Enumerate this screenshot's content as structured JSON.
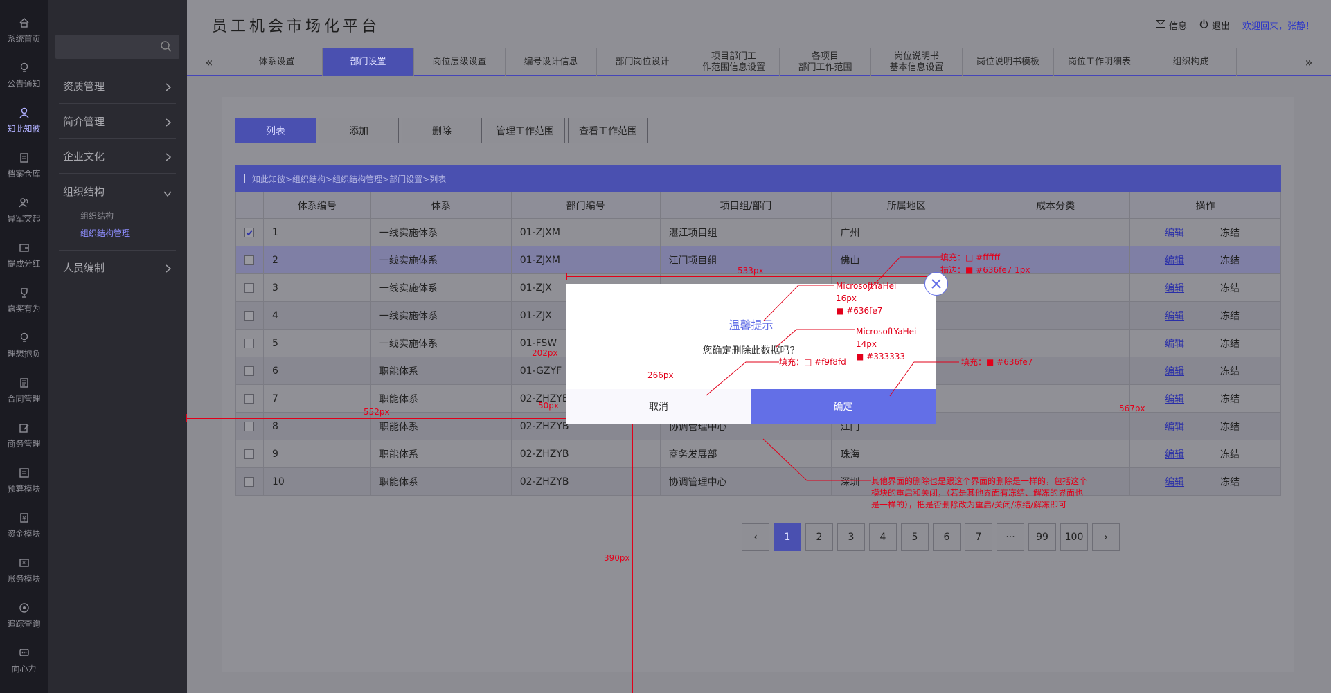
{
  "app": {
    "title": "员工机会市场化平台"
  },
  "rail": [
    {
      "label": "系统首页",
      "icon": "home-icon"
    },
    {
      "label": "公告通知",
      "icon": "bulb-icon"
    },
    {
      "label": "知此知彼",
      "icon": "user-icon",
      "active": true
    },
    {
      "label": "档案仓库",
      "icon": "file-icon"
    },
    {
      "label": "异军突起",
      "icon": "users-icon"
    },
    {
      "label": "提成分红",
      "icon": "wallet-icon"
    },
    {
      "label": "嘉奖有为",
      "icon": "trophy-icon"
    },
    {
      "label": "理想抱负",
      "icon": "bulb-icon"
    },
    {
      "label": "合同管理",
      "icon": "contract-icon"
    },
    {
      "label": "商务管理",
      "icon": "edit-icon"
    },
    {
      "label": "预算模块",
      "icon": "budget-icon"
    },
    {
      "label": "资金模块",
      "icon": "fund-icon"
    },
    {
      "label": "账务模块",
      "icon": "ledger-icon"
    },
    {
      "label": "追踪查询",
      "icon": "target-icon"
    },
    {
      "label": "向心力",
      "icon": "chat-icon"
    }
  ],
  "nav": {
    "groups": [
      "资质管理",
      "简介管理",
      "企业文化",
      "组织结构",
      "人员编制"
    ],
    "sub_items": [
      "组织结构",
      "组织结构管理"
    ]
  },
  "topbar": {
    "info": "信息",
    "logout": "退出",
    "welcome": "欢迎回来，张静！"
  },
  "tabs": [
    "体系设置",
    "部门设置",
    "岗位层级设置",
    "编号设计信息",
    "部门岗位设计",
    "项目部门工\n作范围信息设置",
    "各项目\n部门工作范围",
    "岗位说明书\n基本信息设置",
    "岗位说明书模板",
    "岗位工作明细表",
    "组织构成"
  ],
  "actions": {
    "list": "列表",
    "add": "添加",
    "delete": "删除",
    "manage_scope": "管理工作范围",
    "view_scope": "查看工作范围"
  },
  "breadcrumb": "知此知彼>组织结构>组织结构管理>部门设置>列表",
  "table": {
    "headers": [
      "",
      "体系编号",
      "体系",
      "部门编号",
      "项目组/部门",
      "所属地区",
      "成本分类",
      "操作"
    ],
    "edit_label": "编辑",
    "freeze_label": "冻结",
    "rows": [
      {
        "no": "1",
        "system": "一线实施体系",
        "dept_code": "01-ZJXM",
        "dept": "湛江项目组",
        "region": "广州",
        "checked": true
      },
      {
        "no": "2",
        "system": "一线实施体系",
        "dept_code": "01-ZJXM",
        "dept": "江门项目组",
        "region": "佛山",
        "checked": false
      },
      {
        "no": "3",
        "system": "一线实施体系",
        "dept_code": "01-ZJX",
        "dept": "",
        "region": "",
        "checked": false
      },
      {
        "no": "4",
        "system": "一线实施体系",
        "dept_code": "01-ZJX",
        "dept": "",
        "region": "",
        "checked": false
      },
      {
        "no": "5",
        "system": "一线实施体系",
        "dept_code": "01-FSW",
        "dept": "",
        "region": "",
        "checked": false
      },
      {
        "no": "6",
        "system": "职能体系",
        "dept_code": "01-GZYF",
        "dept": "",
        "region": "",
        "checked": false
      },
      {
        "no": "7",
        "system": "职能体系",
        "dept_code": "02-ZHZYB",
        "dept": "",
        "region": "",
        "checked": false
      },
      {
        "no": "8",
        "system": "职能体系",
        "dept_code": "02-ZHZYB",
        "dept": "协调管理中心",
        "region": "江门",
        "checked": false
      },
      {
        "no": "9",
        "system": "职能体系",
        "dept_code": "02-ZHZYB",
        "dept": "商务发展部",
        "region": "珠海",
        "checked": false
      },
      {
        "no": "10",
        "system": "职能体系",
        "dept_code": "02-ZHZYB",
        "dept": "协调管理中心",
        "region": "深圳",
        "checked": false
      }
    ]
  },
  "pagination": {
    "prev": "‹",
    "next": "›",
    "pages": [
      "1",
      "2",
      "3",
      "4",
      "5",
      "6",
      "7",
      "···",
      "99",
      "100"
    ],
    "current": "1"
  },
  "dialog": {
    "title": "温馨提示",
    "message": "您确定删除此数据吗？",
    "cancel": "取消",
    "confirm": "确定"
  },
  "annotations": {
    "close_fill": "填充：□ #ffffff",
    "close_stroke": "描边：■ #636fe7 1px",
    "title_font": "MicrosoftYaHei",
    "title_size": "16px",
    "title_color": "■ #636fe7",
    "msg_font": "MicrosoftYaHei",
    "msg_size": "14px",
    "msg_color": "■ #333333",
    "cancel_fill": "填充：□ #f9f8fd",
    "ok_fill": "填充：■ #636fe7",
    "dim_533": "533px",
    "dim_202": "202px",
    "dim_266": "266px",
    "dim_50": "50px",
    "dim_552": "552px",
    "dim_567": "567px",
    "dim_390": "390px",
    "note_line1": "其他界面的删除也是跟这个界面的删除是一样的，包括这个",
    "note_line2": "模块的重启和关闭，（若是其他界面有冻结、解冻的界面也",
    "note_line3": "是一样的），把是否删除改为重启/关闭/冻结/解冻即可"
  },
  "colors": {
    "accent": "#636fe7",
    "text": "#333333",
    "cancel_bg": "#f9f8fd",
    "annotation": "#e2001a"
  }
}
